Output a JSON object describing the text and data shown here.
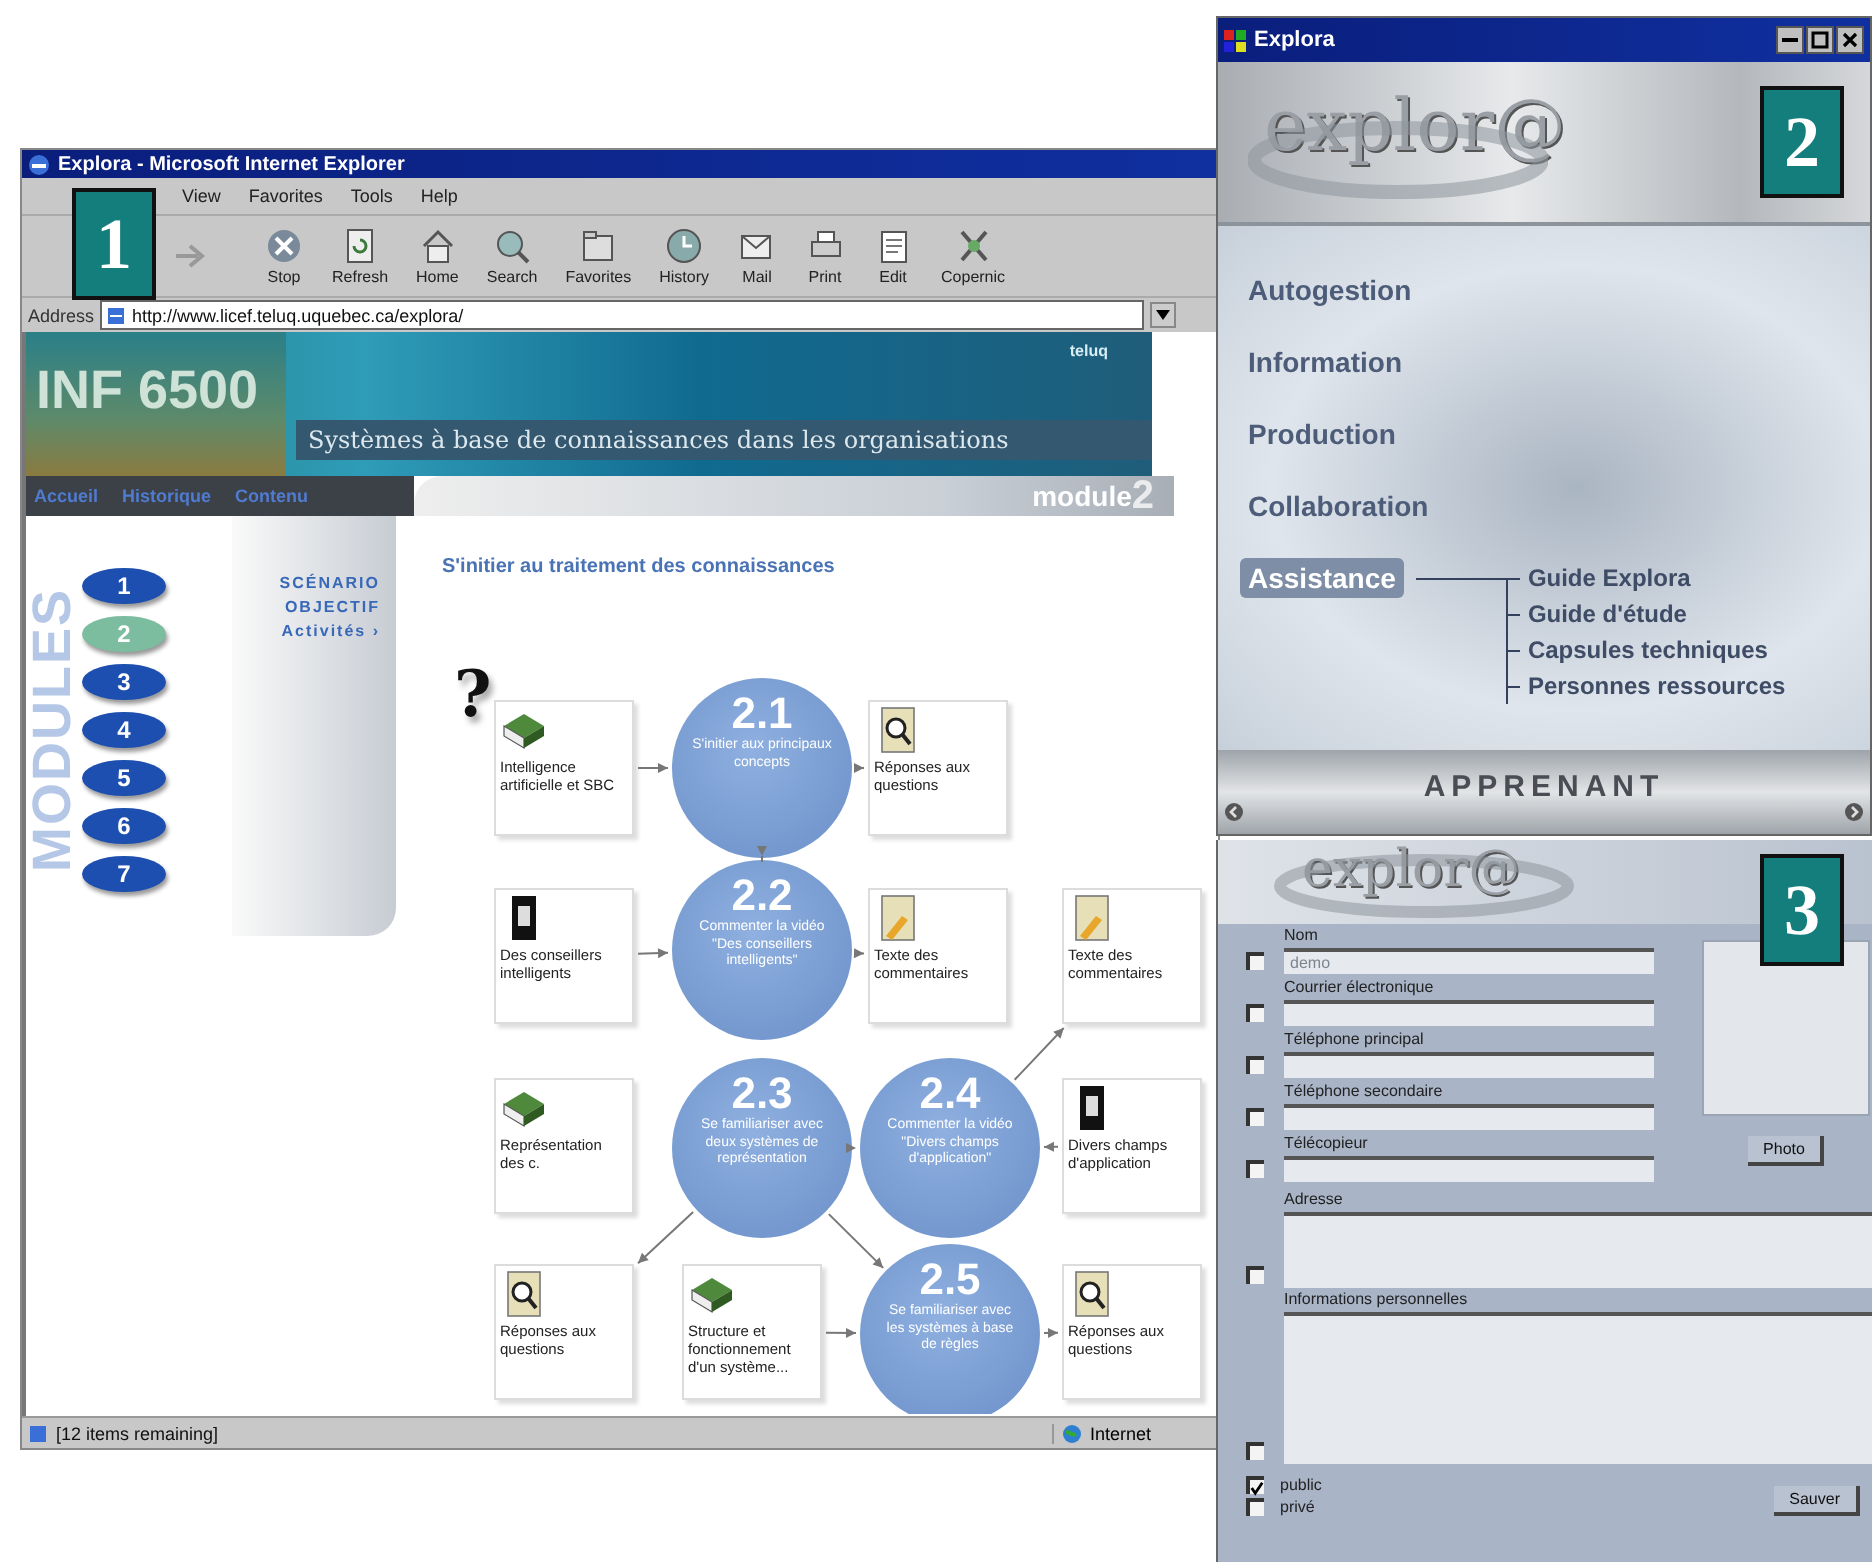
{
  "callouts": [
    "1",
    "2",
    "3"
  ],
  "browser": {
    "title": "Explora - Microsoft Internet Explorer",
    "menu": [
      "View",
      "Favorites",
      "Tools",
      "Help"
    ],
    "toolbar": [
      {
        "kind": "stop",
        "label": "Stop"
      },
      {
        "kind": "refresh",
        "label": "Refresh"
      },
      {
        "kind": "home",
        "label": "Home"
      },
      {
        "kind": "search",
        "label": "Search"
      },
      {
        "kind": "favorites",
        "label": "Favorites"
      },
      {
        "kind": "history",
        "label": "History"
      },
      {
        "kind": "mail",
        "label": "Mail"
      },
      {
        "kind": "print",
        "label": "Print"
      },
      {
        "kind": "edit",
        "label": "Edit"
      },
      {
        "kind": "copernic",
        "label": "Copernic"
      }
    ],
    "address": {
      "label": "Address",
      "url": "http://www.licef.teluq.uquebec.ca/explora/"
    },
    "page": {
      "banner": {
        "course": "INF 6500",
        "brand": "teluq",
        "subtitle": "Systèmes à base de connaissances dans les organisations"
      },
      "nav": [
        "Accueil",
        "Historique",
        "Contenu"
      ],
      "module_banner": {
        "word": "module",
        "number": "2"
      },
      "modules": {
        "heading": "MODULES",
        "items": [
          {
            "label": "1",
            "selected": false
          },
          {
            "label": "2",
            "selected": true
          },
          {
            "label": "3",
            "selected": false
          },
          {
            "label": "4",
            "selected": false
          },
          {
            "label": "5",
            "selected": false
          },
          {
            "label": "6",
            "selected": false
          },
          {
            "label": "7",
            "selected": false
          }
        ]
      },
      "side_links": [
        "SCÉNARIO",
        "OBJECTIF",
        "Activités ›"
      ],
      "title": "S'initier au traitement des connaissances",
      "diagram": {
        "nodes": [
          {
            "kind": "question",
            "text": "?"
          },
          {
            "kind": "book",
            "text": "Intelligence artificielle et SBC"
          },
          {
            "kind": "step",
            "number": "2.1",
            "text": "S'initier aux principaux concepts"
          },
          {
            "kind": "answers",
            "text": "Réponses aux questions"
          },
          {
            "kind": "video",
            "text": "Des conseillers intelligents"
          },
          {
            "kind": "step",
            "number": "2.2",
            "text": "Commenter la vidéo \"Des conseillers intelligents\""
          },
          {
            "kind": "notes",
            "text": "Texte des commentaires"
          },
          {
            "kind": "notes",
            "text": "Texte des commentaires"
          },
          {
            "kind": "book",
            "text": "Représentation des c."
          },
          {
            "kind": "step",
            "number": "2.3",
            "text": "Se familiariser avec deux systèmes de représentation"
          },
          {
            "kind": "step",
            "number": "2.4",
            "text": "Commenter la vidéo \"Divers champs d'application\""
          },
          {
            "kind": "video",
            "text": "Divers champs d'application"
          },
          {
            "kind": "answers",
            "text": "Réponses aux questions"
          },
          {
            "kind": "book",
            "text": "Structure et fonctionnement d'un système..."
          },
          {
            "kind": "step",
            "number": "2.5",
            "text": "Se familiariser avec les systèmes à base de règles"
          },
          {
            "kind": "answers",
            "text": "Réponses aux questions"
          }
        ]
      }
    },
    "status_bar": {
      "text": "[12 items remaining]",
      "zone": "Internet"
    }
  },
  "explora": {
    "title": "Explora",
    "logo": "explor@",
    "menu": [
      {
        "label": "Autogestion",
        "selected": false
      },
      {
        "label": "Information",
        "selected": false
      },
      {
        "label": "Production",
        "selected": false
      },
      {
        "label": "Collaboration",
        "selected": false
      },
      {
        "label": "Assistance",
        "selected": true,
        "children": [
          {
            "label": "Guide Explora"
          },
          {
            "label": "Guide d'étude"
          },
          {
            "label": "Capsules techniques"
          },
          {
            "label": "Personnes ressources"
          }
        ]
      }
    ],
    "footer": "APPRENANT"
  },
  "profile": {
    "logo": "explor@",
    "fields": [
      {
        "kind": "line",
        "label": "Nom",
        "placeholder": "demo",
        "checked": false
      },
      {
        "kind": "line",
        "label": "Courrier électronique",
        "checked": false
      },
      {
        "kind": "line",
        "label": "Téléphone principal",
        "checked": false
      },
      {
        "kind": "line",
        "label": "Téléphone secondaire",
        "checked": false
      },
      {
        "kind": "line",
        "label": "Télécopieur",
        "checked": false
      },
      {
        "kind": "area",
        "label": "Adresse",
        "checked": false
      },
      {
        "kind": "area",
        "label": "Informations personnelles",
        "checked": false
      }
    ],
    "photo_button": "Photo",
    "visibility": [
      {
        "label": "public",
        "checked": true
      },
      {
        "label": "privé",
        "checked": false
      }
    ],
    "save_button": "Sauver"
  }
}
